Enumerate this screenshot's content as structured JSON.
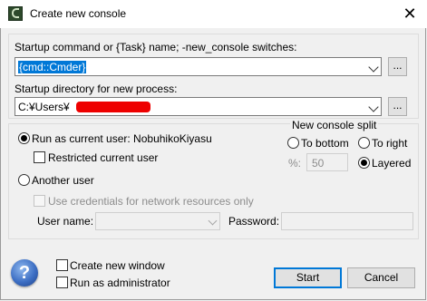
{
  "window": {
    "title": "Create new console",
    "close_glyph": "✕"
  },
  "startup_command": {
    "label": "Startup command or {Task} name; -new_console switches:",
    "value": "{cmd::Cmder}",
    "browse_label": "..."
  },
  "startup_directory": {
    "label": "Startup directory for new process:",
    "value": "C:¥Users¥",
    "browse_label": "..."
  },
  "user": {
    "run_as_current": "Run as current user: NobuhikoKiyasu",
    "restricted": "Restricted current user",
    "another_user": "Another user",
    "use_credentials": "Use credentials for network resources only",
    "user_name_label": "User name:",
    "user_name_value": "",
    "password_label": "Password:",
    "password_value": ""
  },
  "split": {
    "title": "New console split",
    "to_bottom": "To bottom",
    "to_right": "To right",
    "percent_label": "%:",
    "percent_value": "50",
    "layered": "Layered"
  },
  "footer": {
    "help_glyph": "?",
    "create_new_window": "Create new window",
    "run_as_admin": "Run as administrator",
    "start": "Start",
    "cancel": "Cancel"
  },
  "colors": {
    "accent": "#0078d7",
    "redaction": "#ee0000"
  }
}
